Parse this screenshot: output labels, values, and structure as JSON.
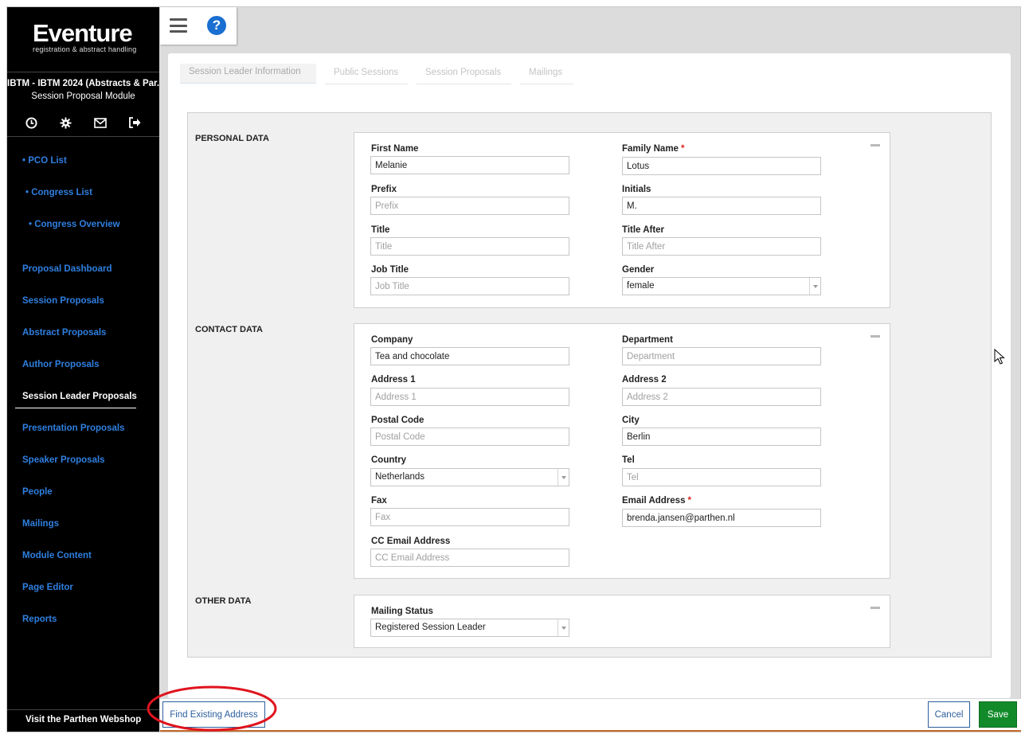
{
  "logo": {
    "name": "Eventure",
    "tagline": "registration & abstract handling"
  },
  "sidebar": {
    "event_name": "IBTM - IBTM 2024 (Abstracts & Par...",
    "module_name": "Session Proposal Module",
    "icons": [
      "clock-icon",
      "gear-icon",
      "mail-icon",
      "sign-out-icon"
    ],
    "items": [
      {
        "label": "• PCO List"
      },
      {
        "label": "• Congress List"
      },
      {
        "label": "• Congress Overview"
      },
      {
        "label": "Proposal Dashboard"
      },
      {
        "label": "Session Proposals"
      },
      {
        "label": "Abstract Proposals"
      },
      {
        "label": "Author Proposals"
      },
      {
        "label": "Session Leader Proposals",
        "active": true
      },
      {
        "label": "Presentation Proposals"
      },
      {
        "label": "Speaker Proposals"
      },
      {
        "label": "People"
      },
      {
        "label": "Mailings"
      },
      {
        "label": "Module Content"
      },
      {
        "label": "Page Editor"
      },
      {
        "label": "Reports"
      }
    ],
    "footer_link": "Visit the Parthen Webshop"
  },
  "toolbar": {
    "menu_icon": "hamburger-menu-icon",
    "help_icon": "help-icon",
    "help_glyph": "?"
  },
  "tabs": [
    {
      "label": "Session Leader Information",
      "active": true
    },
    {
      "label": "Public Sessions"
    },
    {
      "label": "Session Proposals"
    },
    {
      "label": "Mailings"
    }
  ],
  "personal": {
    "title": "PERSONAL DATA",
    "first_name": {
      "label": "First Name",
      "value": "Melanie",
      "placeholder": "First Name"
    },
    "family_name": {
      "label": "Family Name",
      "value": "Lotus",
      "placeholder": "Family Name",
      "required": "*"
    },
    "prefix": {
      "label": "Prefix",
      "value": "",
      "placeholder": "Prefix"
    },
    "initials": {
      "label": "Initials",
      "value": "M.",
      "placeholder": "Initials"
    },
    "title_field": {
      "label": "Title",
      "value": "",
      "placeholder": "Title"
    },
    "title_after": {
      "label": "Title After",
      "value": "",
      "placeholder": "Title After"
    },
    "job_title": {
      "label": "Job Title",
      "value": "",
      "placeholder": "Job Title"
    },
    "gender": {
      "label": "Gender",
      "value": "female"
    }
  },
  "contact": {
    "title": "CONTACT DATA",
    "company": {
      "label": "Company",
      "value": "Tea and chocolate",
      "placeholder": "Company"
    },
    "department": {
      "label": "Department",
      "value": "",
      "placeholder": "Department"
    },
    "address1": {
      "label": "Address 1",
      "value": "",
      "placeholder": "Address 1"
    },
    "address2": {
      "label": "Address 2",
      "value": "",
      "placeholder": "Address 2"
    },
    "postal_code": {
      "label": "Postal Code",
      "value": "",
      "placeholder": "Postal Code"
    },
    "city": {
      "label": "City",
      "value": "Berlin",
      "placeholder": "City"
    },
    "country": {
      "label": "Country",
      "value": "Netherlands"
    },
    "tel": {
      "label": "Tel",
      "value": "",
      "placeholder": "Tel"
    },
    "fax": {
      "label": "Fax",
      "value": "",
      "placeholder": "Fax"
    },
    "email": {
      "label": "Email Address",
      "value": "brenda.jansen@parthen.nl",
      "placeholder": "Email Address",
      "required": "*"
    },
    "cc_email": {
      "label": "CC Email Address",
      "value": "",
      "placeholder": "CC Email Address"
    }
  },
  "other": {
    "title": "OTHER DATA",
    "mailing_status": {
      "label": "Mailing Status",
      "value": "Registered Session Leader"
    }
  },
  "footer": {
    "find_label": "Find Existing Address",
    "cancel_label": "Cancel",
    "save_label": "Save"
  },
  "colors": {
    "link_blue": "#2f7fe0",
    "save_green": "#128a2a",
    "annotation_red": "#e0141e",
    "required_red": "#d9261c"
  }
}
